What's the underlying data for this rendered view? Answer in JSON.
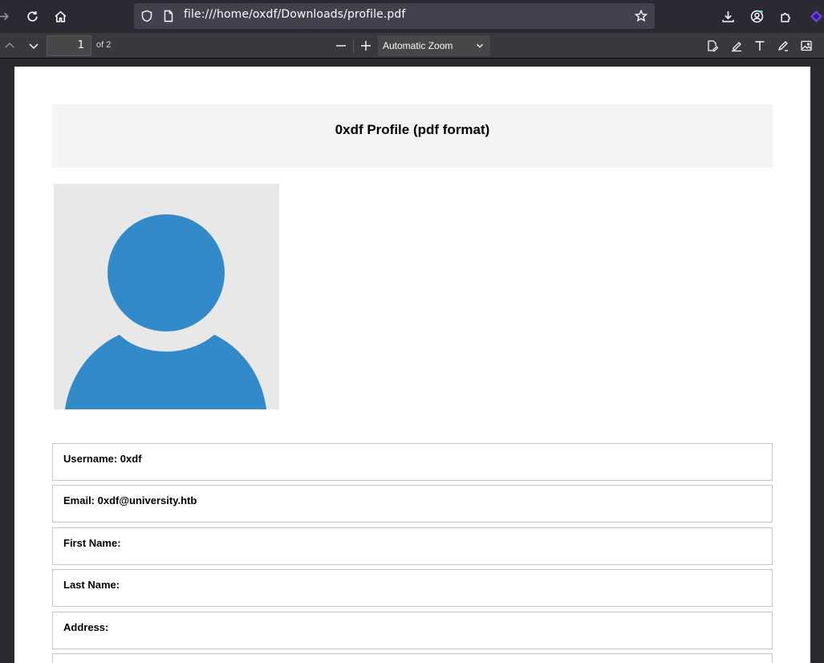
{
  "browser": {
    "url": "file:///home/oxdf/Downloads/profile.pdf"
  },
  "pdf_toolbar": {
    "page_number": "1",
    "page_count": "of 2",
    "zoom": "Automatic Zoom"
  },
  "document": {
    "title": "0xdf Profile (pdf format)",
    "fields": [
      {
        "label": "Username: 0xdf"
      },
      {
        "label": "Email: 0xdf@university.htb"
      },
      {
        "label": "First Name:"
      },
      {
        "label": "Last Name:"
      },
      {
        "label": "Address:"
      },
      {
        "label": ""
      }
    ]
  },
  "colors": {
    "avatar_blue": "#338ac9",
    "avatar_bg": "#e8e8e8"
  }
}
